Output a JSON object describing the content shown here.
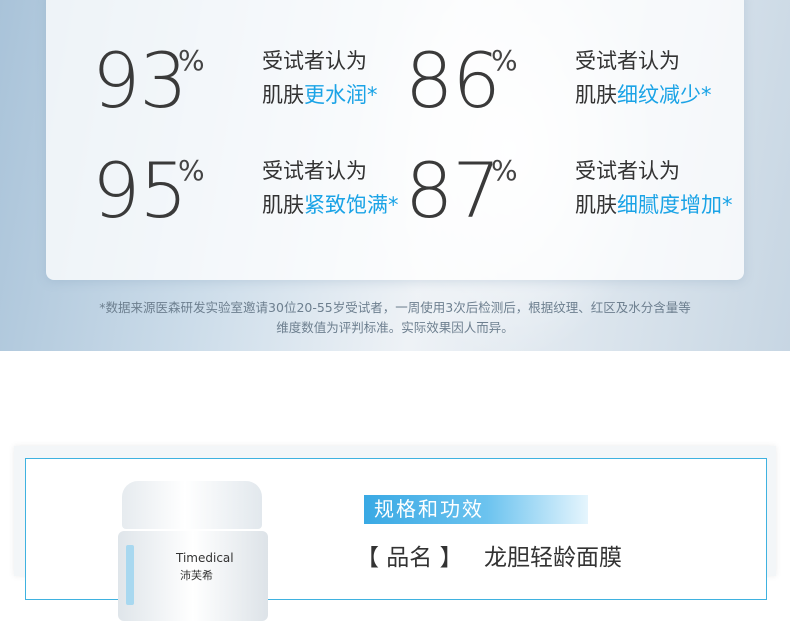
{
  "stats": [
    {
      "number": "93",
      "percent": "%",
      "line1": "受试者认为",
      "prefix": "肌肤",
      "highlight": "更水润*"
    },
    {
      "number": "86",
      "percent": "%",
      "line1": "受试者认为",
      "prefix": "肌肤",
      "highlight": "细纹减少*"
    },
    {
      "number": "95",
      "percent": "%",
      "line1": "受试者认为",
      "prefix": "肌肤",
      "highlight": "紧致饱满*"
    },
    {
      "number": "87",
      "percent": "%",
      "line1": "受试者认为",
      "prefix": "肌肤",
      "highlight": "细腻度增加*"
    }
  ],
  "footnote": {
    "line1": "*数据来源医森研发实验室邀请30位20-55岁受试者，一周使用3次后检测后，根据纹理、红区及水分含量等",
    "line2": "维度数值为评判标准。实际效果因人而异。"
  },
  "product": {
    "jar_brand": "Timedical",
    "jar_brand_cn": "沛芙希",
    "section_title": "规格和功效",
    "name_label": "【 品名 】",
    "name_value": "龙胆轻龄面膜"
  },
  "colors": {
    "highlight": "#1aa3e6",
    "frame": "#3fb2e0"
  }
}
